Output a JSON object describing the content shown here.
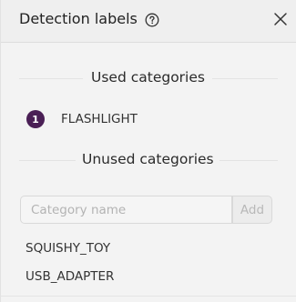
{
  "panel": {
    "title": "Detection labels",
    "icons": {
      "help": "help-circle-icon",
      "close": "close-icon"
    }
  },
  "used": {
    "heading": "Used categories",
    "items": [
      {
        "count": "1",
        "label": "FLASHLIGHT"
      }
    ]
  },
  "unused": {
    "heading": "Unused categories",
    "input": {
      "placeholder": "Category name",
      "value": ""
    },
    "add_label": "Add",
    "items": [
      {
        "label": "SQUISHY_TOY"
      },
      {
        "label": "USB_ADAPTER"
      }
    ]
  },
  "colors": {
    "badge": "#4a1f55",
    "panel_bg": "#f3f3f3"
  }
}
